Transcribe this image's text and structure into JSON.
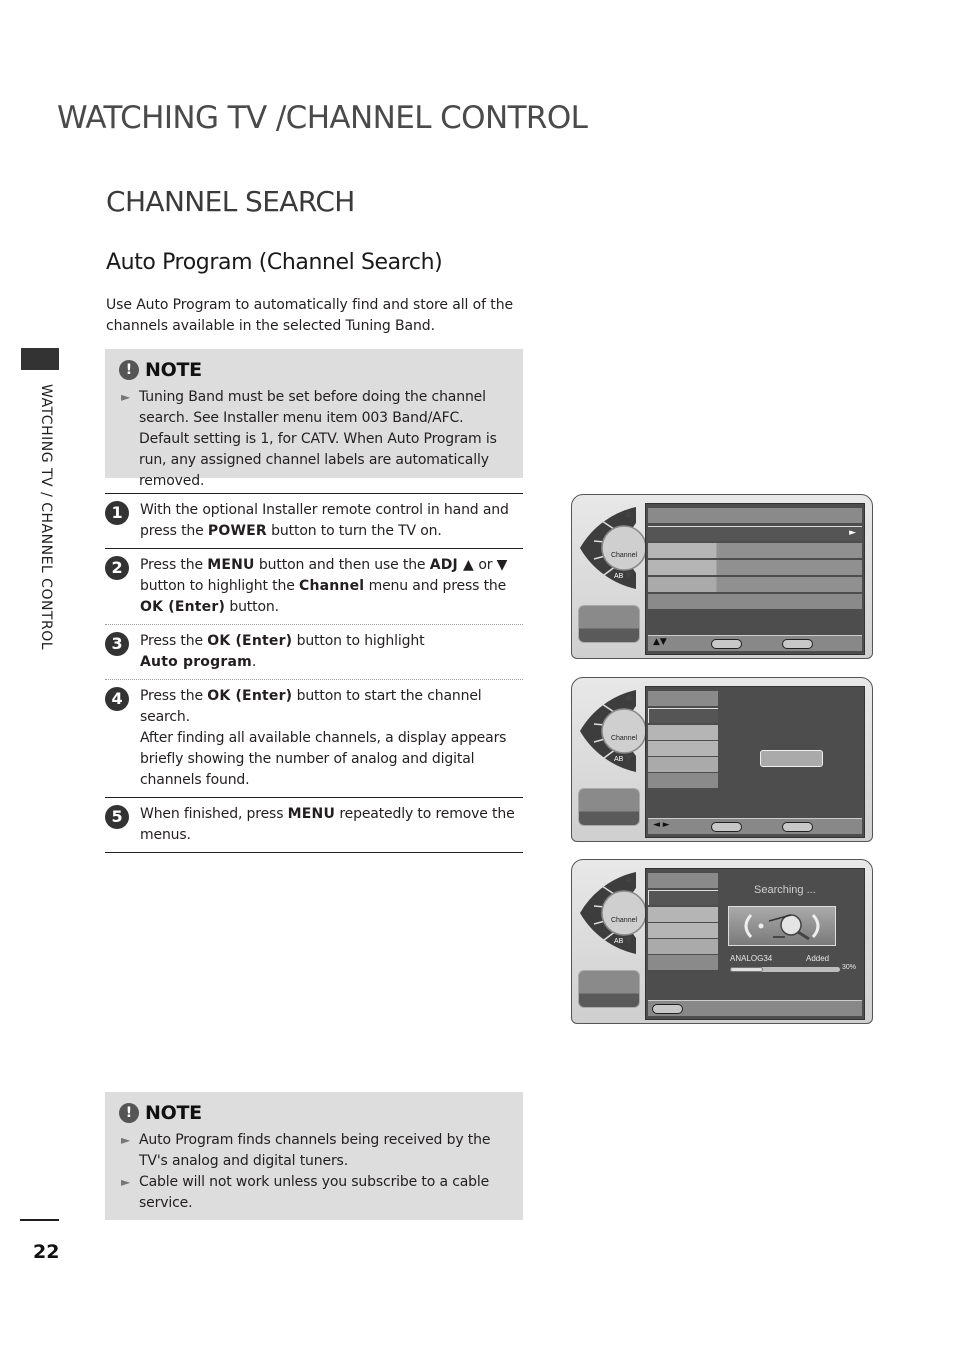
{
  "page": {
    "header": "WATCHING TV /CHANNEL CONTROL",
    "section_title": "CHANNEL SEARCH",
    "subsection_title": "Auto Program (Channel Search)",
    "intro": "Use Auto Program to automatically find and store all of the channels available in the selected Tuning Band.",
    "side_label": "WATCHING TV / CHANNEL CONTROL",
    "page_number": "22"
  },
  "note1": {
    "icon": "!",
    "title": "NOTE",
    "bullet": "►",
    "items": [
      "Tuning Band must be set before doing the channel search. See Installer menu item 003 Band/AFC. Default setting is 1, for CATV. When Auto Program is run, any assigned channel labels are automatically removed."
    ]
  },
  "steps": [
    {
      "num": "1",
      "parts": [
        "With the optional Installer remote control in hand and press the ",
        "POWER",
        " button to turn the TV on."
      ]
    },
    {
      "num": "2",
      "parts": [
        "Press the ",
        "MENU",
        " button and then use the ",
        "ADJ ▲",
        " or ",
        "▼",
        " button to highlight the ",
        "Channel",
        " menu and press the ",
        "OK (Enter)",
        " button."
      ]
    },
    {
      "num": "3",
      "parts": [
        "Press the ",
        "OK (Enter)",
        " button to highlight ",
        "Auto program",
        "."
      ]
    },
    {
      "num": "4",
      "parts": [
        "Press the ",
        "OK (Enter)",
        " button to start the channel search.",
        "After finding all available channels, a display appears briefly showing the number of analog and digital channels found."
      ]
    },
    {
      "num": "5",
      "parts": [
        "When finished, press ",
        "MENU",
        " repeatedly to remove the menus."
      ]
    }
  ],
  "note2": {
    "icon": "!",
    "title": "NOTE",
    "bullet": "►",
    "items": [
      "Auto Program finds channels being received by the TV's analog and digital tuners.",
      "Cable will not work unless you subscribe to a cable service."
    ]
  },
  "osd": {
    "wheel_label": "Channel",
    "wheel_ab": "AB",
    "up_arrow": "▲",
    "down_arrow": "▼",
    "screen1": {
      "nav": "▲▼",
      "row_arrow": "►"
    },
    "screen2": {
      "nav": "◄ ►"
    },
    "screen3": {
      "status": "Searching ...",
      "channel": "ANALOG34",
      "result": "Added",
      "progress_label": "30%",
      "progress": 0.3
    }
  }
}
